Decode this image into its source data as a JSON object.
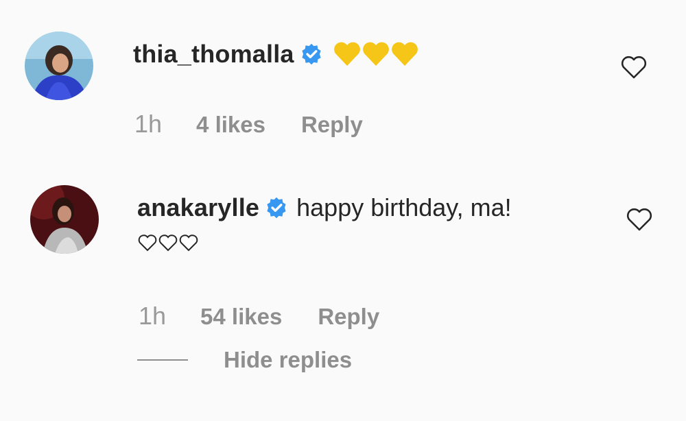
{
  "comments": [
    {
      "username": "thia_thomalla",
      "verified": true,
      "text": "",
      "emoji": [
        "yellow-heart",
        "yellow-heart",
        "yellow-heart"
      ],
      "time": "1h",
      "likes": "4 likes",
      "reply_label": "Reply"
    },
    {
      "username": "anakarylle",
      "verified": true,
      "text": "happy birthday, ma!",
      "emoji": [
        "white-heart",
        "white-heart",
        "white-heart"
      ],
      "time": "1h",
      "likes": "54 likes",
      "reply_label": "Reply"
    }
  ],
  "hide_replies_label": "Hide replies",
  "colors": {
    "verified_blue": "#3897f0",
    "yellow_heart": "#f5c518",
    "muted_text": "#8e8e8e",
    "background": "#fafafa"
  }
}
